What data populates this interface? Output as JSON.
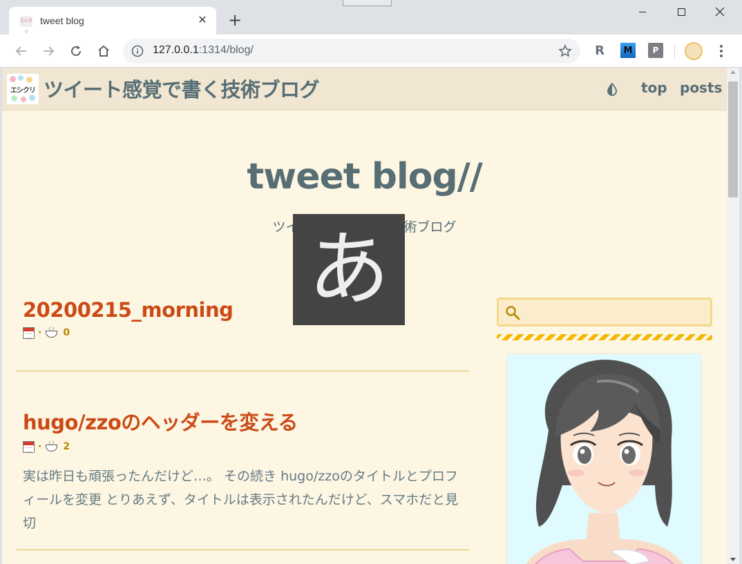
{
  "browser": {
    "tab_title": "tweet blog",
    "tab_favicon_text": "エシクリ",
    "tab_close": "✕",
    "new_tab": "+",
    "url_host": "127.0.0.1",
    "url_path": ":1314/blog/",
    "extensions": [
      {
        "name": "R",
        "icon": "r-extension-icon"
      },
      {
        "name": "M",
        "icon": "m-extension-icon"
      },
      {
        "name": "P",
        "icon": "p-extension-icon"
      }
    ]
  },
  "site": {
    "logo_text": "エシクリ",
    "title": "ツイート感覚で書く技術ブログ",
    "nav": {
      "top": "top",
      "posts": "posts"
    },
    "theme_toggle_icon": "half-drop-icon"
  },
  "hero": {
    "title": "tweet blog//",
    "subtitle": "ツイート感覚で書く技術ブログ"
  },
  "ime_indicator": "あ",
  "posts": [
    {
      "title": "20200215_morning",
      "separator": "·",
      "comments": "0",
      "excerpt": ""
    },
    {
      "title": "hugo/zzoのヘッダーを変える",
      "separator": "·",
      "comments": "2",
      "excerpt": "実は昨日も頑張ったんだけど…。 その続き hugo/zzoのタイトルとプロフィールを変更 とりあえず、タイトルは表示されたんだけど、スマホだと見切"
    }
  ],
  "sidebar": {
    "search_placeholder": "",
    "search_value": ""
  },
  "colors": {
    "page_bg": "#fdf6e3",
    "header_bg": "#f0e6d2",
    "title_color": "#586e75",
    "post_title": "#cb4b16",
    "meta": "#b58900",
    "divider": "#e0b84a"
  }
}
